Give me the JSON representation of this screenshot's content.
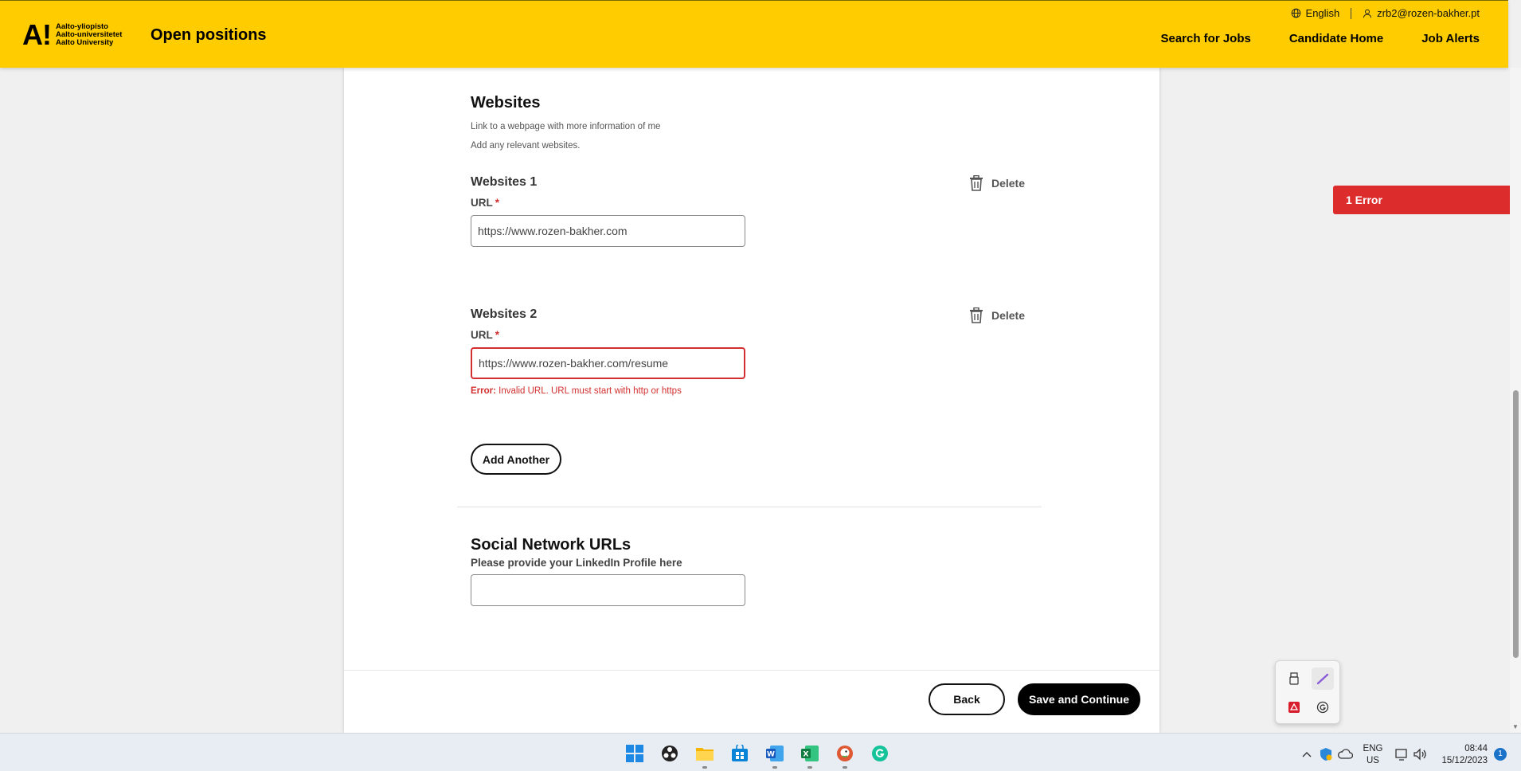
{
  "header": {
    "logo_mark": "A!",
    "logo_lines": [
      "Aalto-yliopisto",
      "Aalto-universitetet",
      "Aalto University"
    ],
    "site_title": "Open positions",
    "language": "English",
    "user_email": "zrb2@rozen-bakher.pt",
    "nav": [
      "Search for Jobs",
      "Candidate Home",
      "Job Alerts"
    ]
  },
  "websites": {
    "title": "Websites",
    "description": "Link to a webpage with more information of me",
    "hint": "Add any relevant websites.",
    "entries": [
      {
        "title": "Websites 1",
        "label": "URL",
        "required_mark": "*",
        "value": "https://www.rozen-bakher.com",
        "delete_label": "Delete"
      },
      {
        "title": "Websites 2",
        "label": "URL",
        "required_mark": "*",
        "value": "https://www.rozen-bakher.com/resume",
        "delete_label": "Delete",
        "error_prefix": "Error:",
        "error_message": "Invalid URL. URL must start with http or https"
      }
    ],
    "add_another_label": "Add Another"
  },
  "social": {
    "title": "Social Network URLs",
    "linkedin_label": "Please provide your LinkedIn Profile here",
    "linkedin_value": ""
  },
  "footer": {
    "back_label": "Back",
    "save_label": "Save and Continue"
  },
  "error_badge": "1 Error",
  "taskbar": {
    "lang_line1": "ENG",
    "lang_line2": "US",
    "time": "08:44",
    "date": "15/12/2023",
    "notification_count": "1",
    "apps": [
      "start-icon",
      "obs-icon",
      "file-explorer-icon",
      "store-icon",
      "word-icon",
      "excel-icon",
      "duckduckgo-icon",
      "grammarly-icon"
    ]
  },
  "colors": {
    "brand_yellow": "#ffcc00",
    "error_red": "#dd2c2c",
    "primary_black": "#000000"
  }
}
